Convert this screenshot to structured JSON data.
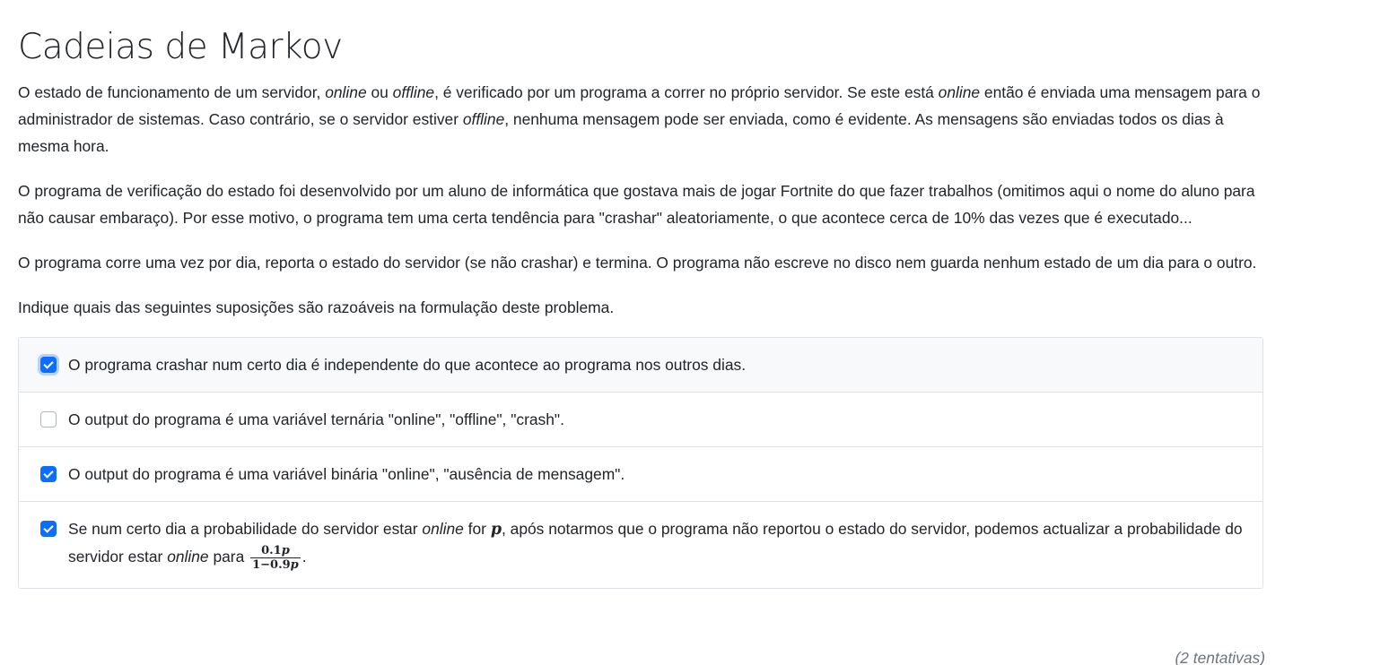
{
  "title": "Cadeias de Markov",
  "paragraph1": {
    "t1": "O estado de funcionamento de um servidor, ",
    "online": "online",
    "t2": " ou ",
    "offline": "offline",
    "t3": ", é verificado por um programa a correr no próprio servidor. Se este está ",
    "online2": "online",
    "t4": " então é enviada uma mensagem para o administrador de sistemas. Caso contrário, se o servidor estiver ",
    "offline2": "offline",
    "t5": ", nenhuma mensagem pode ser enviada, como é evidente. As mensagens são enviadas todos os dias à mesma hora."
  },
  "paragraph2": "O programa de verificação do estado foi desenvolvido por um aluno de informática que gostava mais de jogar Fortnite do que fazer trabalhos (omitimos aqui o nome do aluno para não causar embaraço). Por esse motivo, o programa tem uma certa tendência para \"crashar\" aleatoriamente, o que acontece cerca de 10% das vezes que é executado...",
  "paragraph3": "O programa corre uma vez por dia, reporta o estado do servidor (se não crashar) e termina. O programa não escreve no disco nem guarda nenhum estado de um dia para o outro.",
  "question": "Indique quais das seguintes suposições são razoáveis na formulação deste problema.",
  "options": [
    {
      "text": "O programa crashar num certo dia é independente do que acontece ao programa nos outros dias.",
      "checked": true
    },
    {
      "text": "O output do programa é uma variável ternária \"online\", \"offline\", \"crash\".",
      "checked": false
    },
    {
      "text": "O output do programa é uma variável binária \"online\", \"ausência de mensagem\".",
      "checked": true
    },
    {
      "checked": true,
      "t1": "Se num certo dia a probabilidade do servidor estar ",
      "online": "online",
      "t2": " for ",
      "var": "p",
      "t3": ", após notarmos que o programa não reportou o estado do servidor, podemos actualizar a probabilidade do servidor estar ",
      "online2": "online",
      "t4": " para ",
      "frac_num": "0.1",
      "frac_num_var": "p",
      "frac_den": "1−0.9",
      "frac_den_var": "p",
      "t5": "."
    }
  ],
  "attempts": "(2 tentativas)",
  "colors": {
    "accent": "#0d6efd",
    "border": "#dee2e6",
    "text": "#212529"
  }
}
